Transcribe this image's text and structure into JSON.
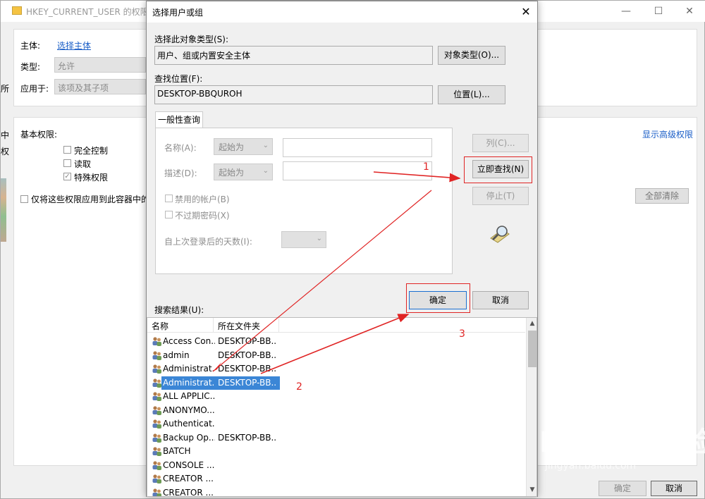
{
  "background_window": {
    "title": "HKEY_CURRENT_USER 的权限项",
    "principal_label": "主体:",
    "principal_link": "选择主体",
    "type_label": "类型:",
    "type_value": "允许",
    "applies_label": "应用于:",
    "applies_value": "该项及其子项",
    "basic_permissions_label": "基本权限:",
    "perm_full": "完全控制",
    "perm_read": "读取",
    "perm_special": "特殊权限",
    "apply_only_label": "仅将这些权限应用到此容器中的",
    "show_advanced_link": "显示高级权限",
    "clear_all_button": "全部清除",
    "ok_button": "确定",
    "cancel_button": "取消",
    "left_fragment_1": "所",
    "left_fragment_2": "中",
    "left_fragment_3": "权"
  },
  "dialog": {
    "title": "选择用户或组",
    "object_type_label": "选择此对象类型(S):",
    "object_type_value": "用户、组或内置安全主体",
    "object_type_button": "对象类型(O)...",
    "location_label": "查找位置(F):",
    "location_value": "DESKTOP-BBQUROH",
    "location_button": "位置(L)...",
    "tab_general": "一般性查询",
    "name_label": "名称(A):",
    "name_mode": "起始为",
    "desc_label": "描述(D):",
    "desc_mode": "起始为",
    "disabled_accounts": "禁用的帐户(B)",
    "non_expiring": "不过期密码(X)",
    "days_since_login": "自上次登录后的天数(I):",
    "columns_button": "列(C)...",
    "find_now_button": "立即查找(N)",
    "stop_button": "停止(T)",
    "ok_button": "确定",
    "cancel_button": "取消",
    "results_label": "搜索结果(U):",
    "results_columns": [
      "名称",
      "所在文件夹"
    ],
    "results": [
      {
        "name": "Access Con...",
        "folder": "DESKTOP-BB..."
      },
      {
        "name": "admin",
        "folder": "DESKTOP-BB..."
      },
      {
        "name": "Administrat...",
        "folder": "DESKTOP-BB..."
      },
      {
        "name": "Administrat...",
        "folder": "DESKTOP-BB...",
        "selected": true
      },
      {
        "name": "ALL APPLIC...",
        "folder": ""
      },
      {
        "name": "ANONYMO...",
        "folder": ""
      },
      {
        "name": "Authenticat...",
        "folder": ""
      },
      {
        "name": "Backup Op...",
        "folder": "DESKTOP-BB..."
      },
      {
        "name": "BATCH",
        "folder": ""
      },
      {
        "name": "CONSOLE ...",
        "folder": ""
      },
      {
        "name": "CREATOR ...",
        "folder": ""
      },
      {
        "name": "CREATOR ...",
        "folder": ""
      }
    ]
  },
  "annotations": {
    "step1": "1",
    "step2": "2",
    "step3": "3",
    "color": "#e02424"
  },
  "watermark": {
    "brand": "Bai du 经验",
    "url": "jingyan.baidu.com"
  }
}
